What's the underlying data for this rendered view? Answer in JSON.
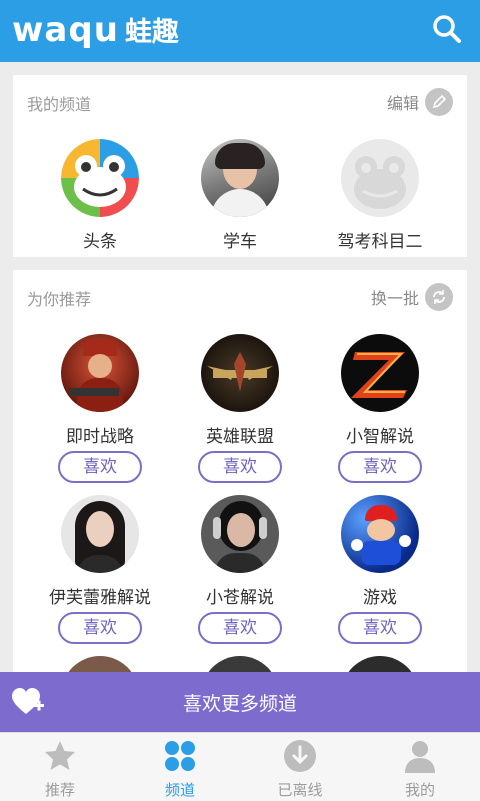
{
  "header": {
    "logo_latin": "waqu",
    "logo_cn": "蛙趣"
  },
  "my_channels": {
    "title": "我的频道",
    "action": "编辑",
    "items": [
      {
        "label": "头条",
        "icon": "frog-logo-icon"
      },
      {
        "label": "学车",
        "icon": "avatar-photo"
      },
      {
        "label": "驾考科目二",
        "icon": "frog-placeholder-icon"
      }
    ]
  },
  "recommend": {
    "title": "为你推荐",
    "action": "换一批",
    "like_label": "喜欢",
    "items": [
      {
        "label": "即时战略"
      },
      {
        "label": "英雄联盟"
      },
      {
        "label": "小智解说"
      },
      {
        "label": "伊芙蕾雅解说"
      },
      {
        "label": "小苍解说"
      },
      {
        "label": "游戏"
      }
    ]
  },
  "more_bar": {
    "label": "喜欢更多频道"
  },
  "tabs": [
    {
      "label": "推荐",
      "icon": "star-icon",
      "active": false
    },
    {
      "label": "频道",
      "icon": "grid-dots-icon",
      "active": true
    },
    {
      "label": "已离线",
      "icon": "download-icon",
      "active": false
    },
    {
      "label": "我的",
      "icon": "person-icon",
      "active": false
    }
  ],
  "colors": {
    "header": "#2b9ee6",
    "accent_purple": "#7d6bcd",
    "like_border": "#7a6fc6"
  }
}
